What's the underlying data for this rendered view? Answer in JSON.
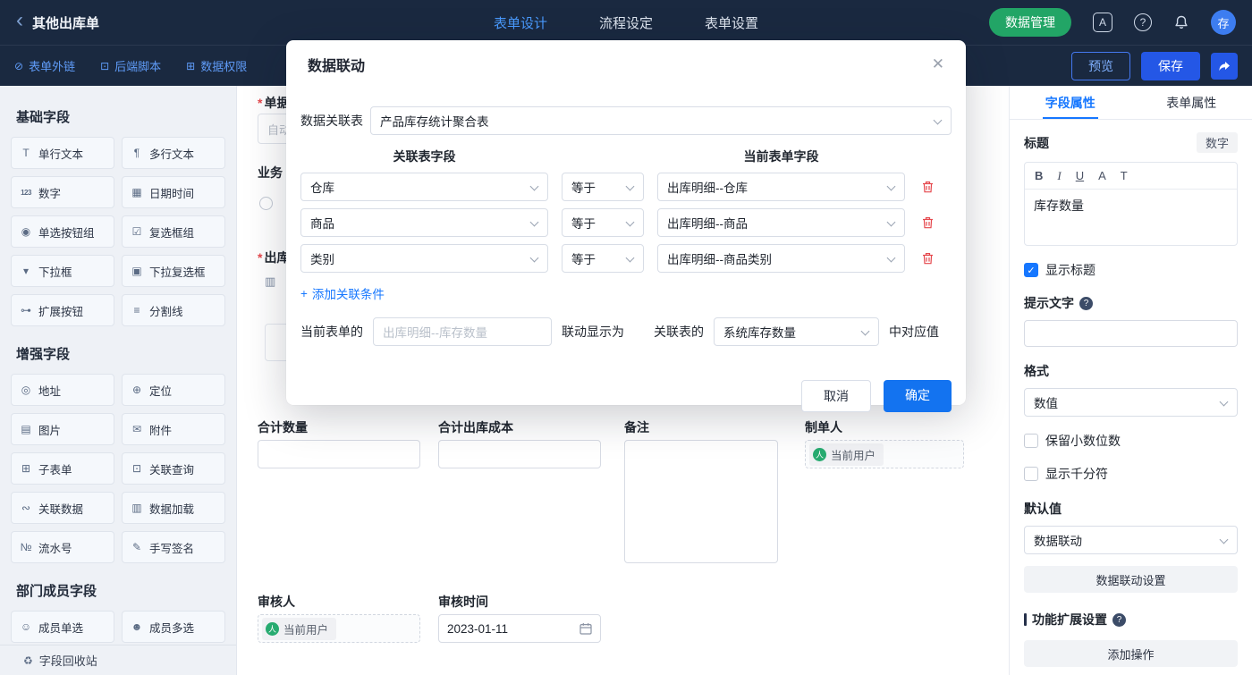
{
  "colors": {
    "accent": "#1677ff",
    "topbar": "#1a2940",
    "green": "#22a566",
    "danger": "#e5484d"
  },
  "icons": {
    "back": "‹",
    "translate": "A",
    "question": "?",
    "close": "✕",
    "check": "✓",
    "plus": "+",
    "user": "人",
    "form_link": "⊘",
    "backend_script": "⊡",
    "data_permission": "⊞",
    "single_line": "T",
    "multi_line": "¶",
    "number": "123",
    "datetime": "▦",
    "radio_group": "◉",
    "checkbox_group": "☑",
    "dropdown": "▾",
    "dropdown_multi": "▣",
    "extend_button": "⊶",
    "divider": "≡",
    "address": "◎",
    "location": "⊕",
    "image": "▤",
    "attachment": "✉",
    "subform": "⊞",
    "related_query": "⊡",
    "related_data": "∾",
    "data_load": "▥",
    "serial_number": "№",
    "signature": "✎",
    "member_single": "☺",
    "member_multi": "☻",
    "recycle": "♻"
  },
  "topbar": {
    "back_title": "其他出库单",
    "tabs": [
      {
        "label": "表单设计",
        "active": true
      },
      {
        "label": "流程设定",
        "active": false
      },
      {
        "label": "表单设置",
        "active": false
      }
    ],
    "data_manage": "数据管理",
    "avatar": "存"
  },
  "toolbar": {
    "items": [
      "表单外链",
      "后端脚本",
      "数据权限"
    ],
    "preview": "预览",
    "save": "保存"
  },
  "sidebar": {
    "sections": [
      {
        "title": "基础字段",
        "items": [
          "单行文本",
          "多行文本",
          "数字",
          "日期时间",
          "单选按钮组",
          "复选框组",
          "下拉框",
          "下拉复选框",
          "扩展按钮",
          "分割线"
        ]
      },
      {
        "title": "增强字段",
        "items": [
          "地址",
          "定位",
          "图片",
          "附件",
          "子表单",
          "关联查询",
          "关联数据",
          "数据加载",
          "流水号",
          "手写签名"
        ]
      },
      {
        "title": "部门成员字段",
        "items": [
          "成员单选",
          "成员多选"
        ]
      }
    ],
    "recycle_bin": "字段回收站"
  },
  "canvas": {
    "fragments": {
      "required_mark": "*",
      "doc_no_label": "单据",
      "auto_value": "自动",
      "biz_label": "业务",
      "outbound_label": "出库"
    },
    "fields": {
      "total_qty_label": "合计数量",
      "total_cost_label": "合计出库成本",
      "remark_label": "备注",
      "creator_label": "制单人",
      "reviewer_label": "审核人",
      "review_time_label": "审核时间",
      "review_time_value": "2023-01-11",
      "current_user_tag": "当前用户"
    }
  },
  "properties": {
    "tabs": [
      {
        "label": "字段属性",
        "active": true
      },
      {
        "label": "表单属性",
        "active": false
      }
    ],
    "title_label": "标题",
    "field_type": "数字",
    "editor_toolbar": [
      "B",
      "I",
      "U",
      "A",
      "T"
    ],
    "title_value": "库存数量",
    "show_title_label": "显示标题",
    "hint_label": "提示文字",
    "format_label": "格式",
    "format_value": "数值",
    "decimal_label": "保留小数位数",
    "thousand_label": "显示千分符",
    "default_label": "默认值",
    "default_value": "数据联动",
    "linkage_button": "数据联动设置",
    "extension_label": "功能扩展设置",
    "add_operation_button": "添加操作"
  },
  "modal": {
    "title": "数据联动",
    "relation_label": "数据关联表",
    "relation_value": "产品库存统计聚合表",
    "left_header": "关联表字段",
    "right_header": "当前表单字段",
    "conditions": [
      {
        "left": "仓库",
        "op": "等于",
        "right": "出库明细--仓库"
      },
      {
        "left": "商品",
        "op": "等于",
        "right": "出库明细--商品"
      },
      {
        "left": "类别",
        "op": "等于",
        "right": "出库明细--商品类别"
      }
    ],
    "add_condition": "添加关联条件",
    "current_form_label": "当前表单的",
    "current_form_placeholder": "出库明细--库存数量",
    "display_as_label": "联动显示为",
    "related_table_label": "关联表的",
    "related_field_value": "系统库存数量",
    "suffix_label": "中对应值",
    "cancel": "取消",
    "confirm": "确定"
  }
}
